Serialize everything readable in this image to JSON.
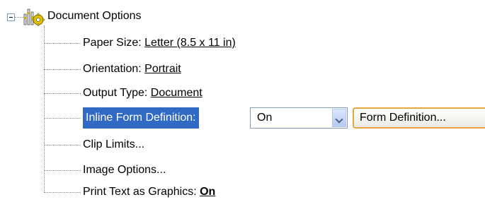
{
  "tree": {
    "root": {
      "label": "Document Options",
      "icon": "document-options-icon",
      "expanded": true
    },
    "items": [
      {
        "label": "Paper Size: ",
        "value": "Letter (8.5 x 11 in)"
      },
      {
        "label": "Orientation: ",
        "value": "Portrait"
      },
      {
        "label": "Output Type: ",
        "value": "Document"
      },
      {
        "label": "Inline Form Definition:",
        "selected": true
      },
      {
        "label": "Clip Limits..."
      },
      {
        "label": "Image Options..."
      },
      {
        "label": "Print Text as Graphics: ",
        "value": "On"
      }
    ],
    "inline_form": {
      "dropdown_value": "On",
      "button_label": "Form Definition..."
    }
  },
  "colors": {
    "selection": "#316ac5",
    "button_focus": "#e8a642",
    "tree_lines": "#8a8a8a"
  }
}
